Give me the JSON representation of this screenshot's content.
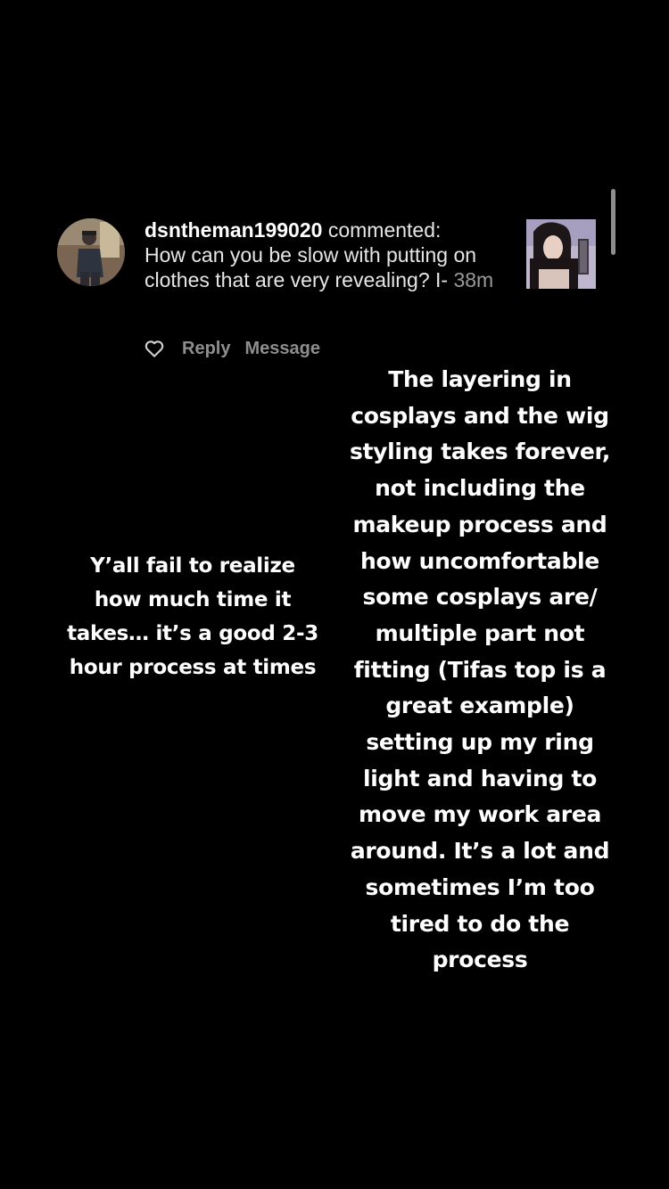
{
  "comment": {
    "username": "dsntheman199020",
    "action": "commented:",
    "text": "How can you be slow with putting on clothes that are very revealing? I-",
    "time": "38m",
    "reply_label": "Reply",
    "message_label": "Message",
    "avatar_icon": "user-avatar",
    "thumbnail_icon": "post-thumbnail",
    "like_icon": "heart-icon"
  },
  "captions": {
    "left": "Y’all fail to realize\nhow much time it\ntakes… it’s a good 2-3\nhour process at times",
    "right": "The layering in\ncosplays and the wig\nstyling takes forever,\nnot including the\nmakeup process and\nhow uncomfortable\nsome cosplays are/\nmultiple part not\nfitting (Tifas top is a\ngreat example)\nsetting up my ring\nlight and having to\nmove my work area\naround. It’s a lot and\nsometimes I’m too\ntired to do the\nprocess"
  },
  "colors": {
    "background": "#000000",
    "text_primary": "#ffffff",
    "text_secondary": "#8e8e8e"
  }
}
